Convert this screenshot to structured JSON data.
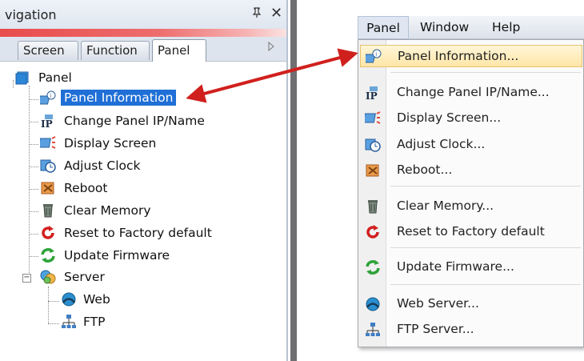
{
  "navigation": {
    "title": "vigation",
    "pin_glyph": "ᵖ",
    "close_glyph": "✕",
    "tabs": [
      {
        "label": "Screen"
      },
      {
        "label": "Function"
      },
      {
        "label": "Panel"
      }
    ],
    "tree": {
      "root": "Panel",
      "items": [
        {
          "label": "Panel Information",
          "icon": "panel-info-icon",
          "selected": true
        },
        {
          "label": "Change Panel IP/Name",
          "icon": "ip-icon"
        },
        {
          "label": "Display Screen",
          "icon": "display-screen-icon"
        },
        {
          "label": "Adjust Clock",
          "icon": "clock-icon"
        },
        {
          "label": "Reboot",
          "icon": "reboot-icon"
        },
        {
          "label": "Clear Memory",
          "icon": "trash-icon"
        },
        {
          "label": "Reset to Factory default",
          "icon": "reset-icon"
        },
        {
          "label": "Update Firmware",
          "icon": "refresh-icon"
        }
      ],
      "server": {
        "label": "Server",
        "children": [
          {
            "label": "Web",
            "icon": "web-icon"
          },
          {
            "label": "FTP",
            "icon": "ftp-icon"
          }
        ]
      }
    }
  },
  "menu": {
    "bar": [
      "Panel",
      "Window",
      "Help"
    ],
    "items": [
      {
        "label": "Panel Information...",
        "icon": "panel-info-icon",
        "highlighted": true
      },
      {
        "label": "Change Panel IP/Name...",
        "icon": "ip-icon"
      },
      {
        "label": "Display Screen...",
        "icon": "display-screen-icon"
      },
      {
        "label": "Adjust Clock...",
        "icon": "clock-icon"
      },
      {
        "label": "Reboot...",
        "icon": "reboot-icon"
      },
      {
        "label": "Clear Memory...",
        "icon": "trash-icon"
      },
      {
        "label": "Reset to Factory default",
        "icon": "reset-icon"
      },
      {
        "label": "Update Firmware...",
        "icon": "refresh-icon"
      },
      {
        "label": "Web Server...",
        "icon": "web-icon"
      },
      {
        "label": "FTP Server...",
        "icon": "ftp-icon"
      }
    ]
  },
  "colors": {
    "selection": "#1f6fd6",
    "arrow": "#d0201d",
    "accent_strip": "#e84c4c",
    "menu_highlight": "#ffe6a8"
  }
}
